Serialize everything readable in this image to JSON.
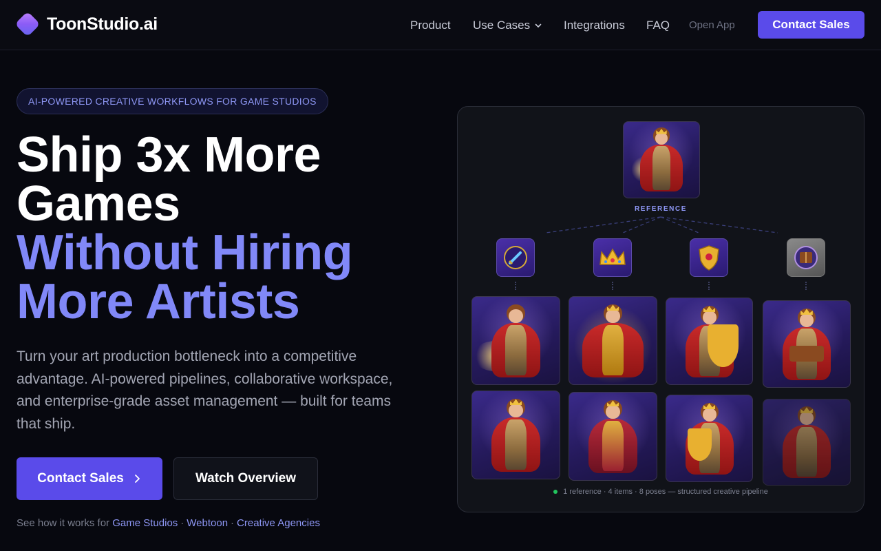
{
  "nav": {
    "brand": "ToonStudio.ai",
    "links": [
      "Product",
      "Use Cases",
      "Integrations",
      "FAQ"
    ],
    "open_app": "Open App",
    "cta": "Contact Sales"
  },
  "hero": {
    "pill": "AI-POWERED CREATIVE WORKFLOWS FOR GAME STUDIOS",
    "headline_lines": [
      "Ship 3x More",
      "Games",
      "Without Hiring",
      "More Artists"
    ],
    "subheadline": "Turn your art production bottleneck into a competitive advantage. AI-powered pipelines, collaborative workspace, and enterprise-grade asset management — built for teams that ship.",
    "primary_cta": "Contact Sales",
    "secondary_cta": "Watch Overview",
    "see_how_prefix": "See how it works for",
    "see_how_links": [
      "Game Studios",
      "Webtoon",
      "Creative Agencies"
    ]
  },
  "pipeline": {
    "reference_label": "REFERENCE",
    "items": [
      {
        "icon": "sword-icon"
      },
      {
        "icon": "crown-icon"
      },
      {
        "icon": "shield-icon"
      },
      {
        "icon": "spellbook-icon"
      }
    ],
    "caption": "1 reference · 4 items · 8 poses — structured creative pipeline",
    "colors": {
      "accent": "#5a4bea",
      "accent_text": "#8188f8",
      "live": "#22c55e"
    }
  }
}
